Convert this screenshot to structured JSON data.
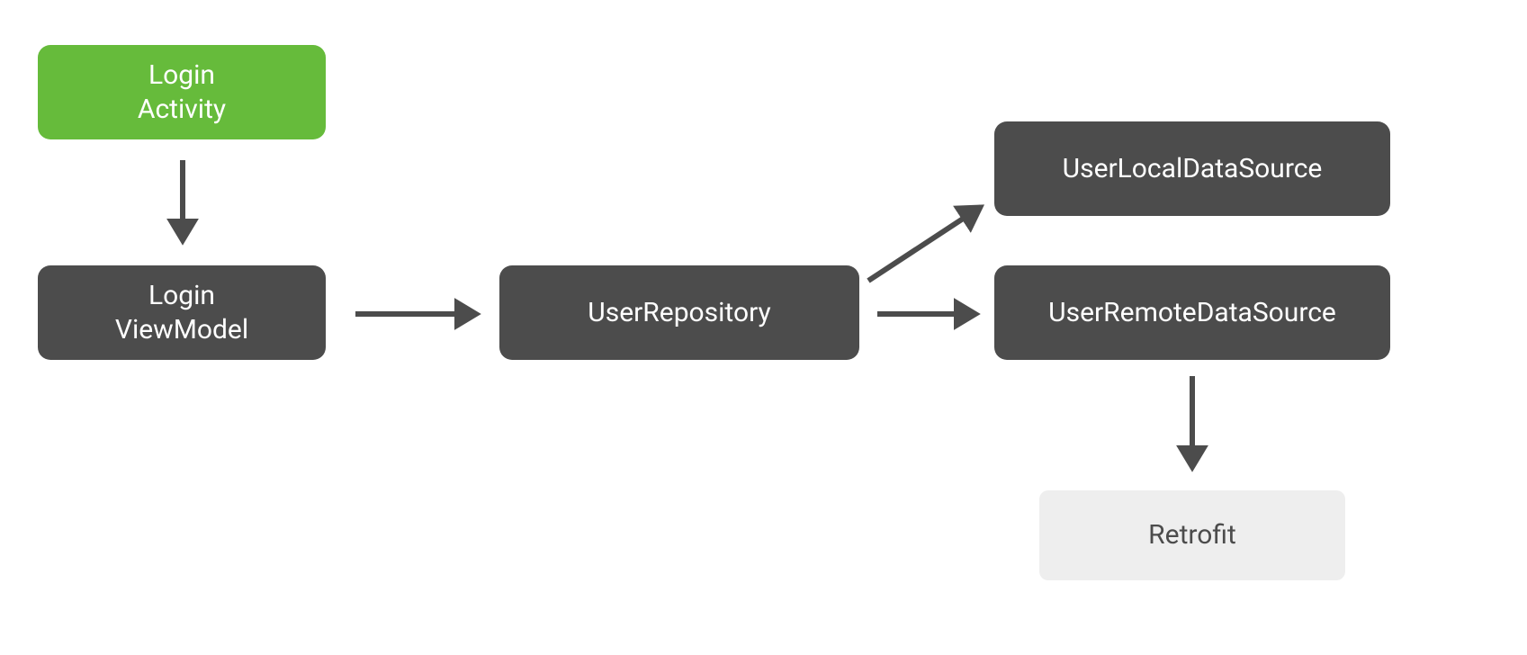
{
  "diagram": {
    "nodes": {
      "loginActivity": {
        "label": "Login\nActivity"
      },
      "loginViewModel": {
        "label": "Login\nViewModel"
      },
      "userRepository": {
        "label": "UserRepository"
      },
      "userLocalDataSource": {
        "label": "UserLocalDataSource"
      },
      "userRemoteDataSource": {
        "label": "UserRemoteDataSource"
      },
      "retrofit": {
        "label": "Retrofit"
      }
    },
    "edges": [
      {
        "from": "loginActivity",
        "to": "loginViewModel"
      },
      {
        "from": "loginViewModel",
        "to": "userRepository"
      },
      {
        "from": "userRepository",
        "to": "userLocalDataSource"
      },
      {
        "from": "userRepository",
        "to": "userRemoteDataSource"
      },
      {
        "from": "userRemoteDataSource",
        "to": "retrofit"
      }
    ],
    "colors": {
      "green": "#66bb3b",
      "dark": "#4c4c4c",
      "light": "#eeeeee"
    }
  }
}
